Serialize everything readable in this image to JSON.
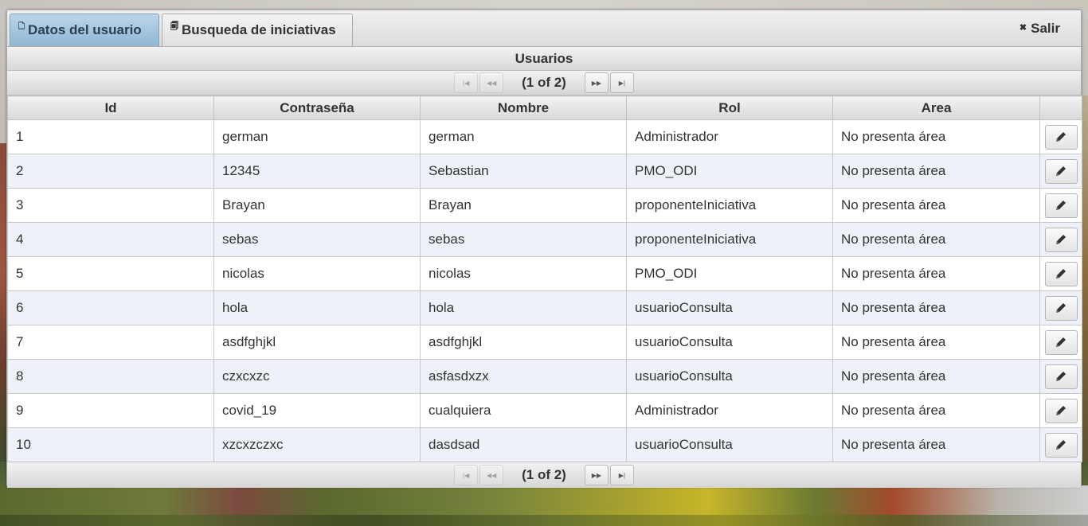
{
  "tabs": [
    {
      "label": "Datos del usuario",
      "active": true,
      "icon": "page-icon"
    },
    {
      "label": "Busqueda de iniciativas",
      "active": false,
      "icon": "search-page-icon"
    }
  ],
  "logout": {
    "label": "Salir",
    "icon": "close-icon"
  },
  "panel": {
    "title": "Usuarios"
  },
  "paginator": {
    "current": "(1 of 2)"
  },
  "table": {
    "columns": [
      "Id",
      "Contraseña",
      "Nombre",
      "Rol",
      "Area",
      ""
    ],
    "rows": [
      {
        "id": "1",
        "password": "german",
        "name": "german",
        "role": "Administrador",
        "area": "No presenta área"
      },
      {
        "id": "2",
        "password": "12345",
        "name": "Sebastian",
        "role": "PMO_ODI",
        "area": "No presenta área"
      },
      {
        "id": "3",
        "password": "Brayan",
        "name": "Brayan",
        "role": "proponenteIniciativa",
        "area": "No presenta área"
      },
      {
        "id": "4",
        "password": "sebas",
        "name": "sebas",
        "role": "proponenteIniciativa",
        "area": "No presenta área"
      },
      {
        "id": "5",
        "password": "nicolas",
        "name": "nicolas",
        "role": "PMO_ODI",
        "area": "No presenta área"
      },
      {
        "id": "6",
        "password": "hola",
        "name": "hola",
        "role": "usuarioConsulta",
        "area": "No presenta área"
      },
      {
        "id": "7",
        "password": "asdfghjkl",
        "name": "asdfghjkl",
        "role": "usuarioConsulta",
        "area": "No presenta área"
      },
      {
        "id": "8",
        "password": "czxcxzc",
        "name": "asfasdxzx",
        "role": "usuarioConsulta",
        "area": "No presenta área"
      },
      {
        "id": "9",
        "password": "covid_19",
        "name": "cualquiera",
        "role": "Administrador",
        "area": "No presenta área"
      },
      {
        "id": "10",
        "password": "xzcxzczxc",
        "name": "dasdsad",
        "role": "usuarioConsulta",
        "area": "No presenta área"
      }
    ],
    "row_action_icon": "pencil-icon"
  },
  "colors": {
    "active_tab": "#8fb7d4",
    "row_alt": "#eef2f8"
  }
}
